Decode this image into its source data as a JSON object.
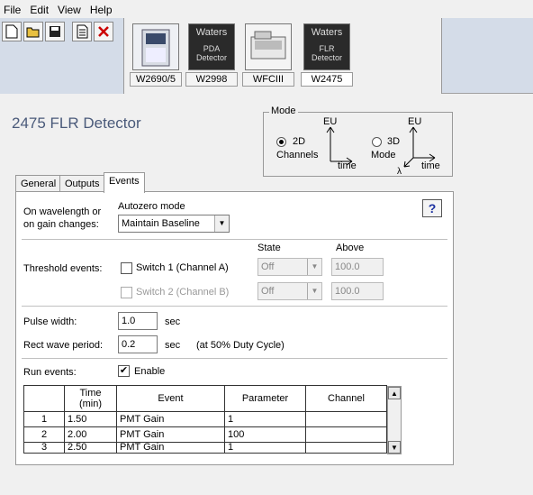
{
  "menu": [
    "File",
    "Edit",
    "View",
    "Help"
  ],
  "instruments": [
    {
      "label": "W2690/5",
      "selected": false
    },
    {
      "label": "W2998",
      "selected": false,
      "brand": "Waters",
      "name": "PDA\nDetector"
    },
    {
      "label": "WFCIII",
      "selected": false
    },
    {
      "label": "W2475",
      "selected": true,
      "brand": "Waters",
      "name": "FLR\nDetector"
    }
  ],
  "title": "2475 FLR Detector",
  "mode": {
    "caption": "Mode",
    "opt2d_line1": "2D",
    "opt2d_line2": "Channels",
    "opt3d_line1": "3D",
    "opt3d_line2": "Mode",
    "axis_eu": "EU",
    "axis_time": "time",
    "axis_lambda": "λ",
    "selected": "2D"
  },
  "tabs": [
    "General",
    "Outputs",
    "Events"
  ],
  "active_tab": "Events",
  "events": {
    "wavelength_label_1": "On wavelength or",
    "wavelength_label_2": "on gain changes:",
    "autozero_label": "Autozero mode",
    "autozero_value": "Maintain Baseline",
    "help": "?",
    "state_header": "State",
    "above_header": "Above",
    "threshold_label": "Threshold events:",
    "switch1_label": "Switch 1 (Channel A)",
    "switch1_state": "Off",
    "switch1_above": "100.0",
    "switch2_label": "Switch 2 (Channel B)",
    "switch2_state": "Off",
    "switch2_above": "100.0",
    "pulse_label": "Pulse width:",
    "pulse_value": "1.0",
    "pulse_unit": "sec",
    "rect_label": "Rect wave period:",
    "rect_value": "0.2",
    "rect_unit": "sec",
    "rect_note": "(at 50% Duty Cycle)",
    "run_label": "Run events:",
    "enable_label": "Enable",
    "enable_checked": true
  },
  "table": {
    "headers": [
      "",
      "Time\n(min)",
      "Event",
      "Parameter",
      "Channel"
    ],
    "rows": [
      [
        "1",
        "1.50",
        "PMT Gain",
        "1",
        ""
      ],
      [
        "2",
        "2.00",
        "PMT Gain",
        "100",
        ""
      ],
      [
        "3",
        "2.50",
        "PMT Gain",
        "1",
        ""
      ]
    ]
  }
}
